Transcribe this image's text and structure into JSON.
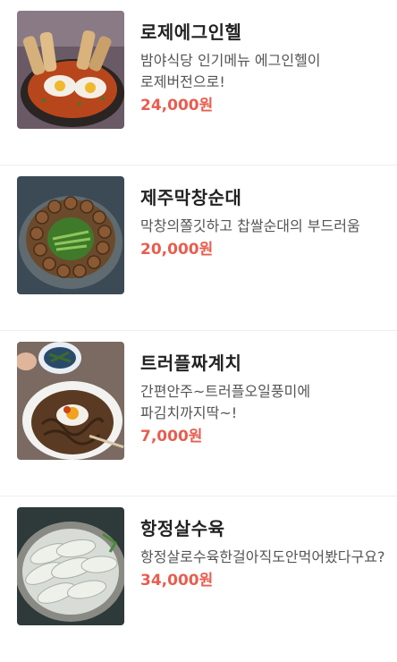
{
  "menu": {
    "items": [
      {
        "name": "로제에그인헬",
        "description": "밤야식당 인기메뉴 에그인헬이 로제버전으로!",
        "price": "24,000원",
        "image": "egg-in-hell-photo"
      },
      {
        "name": "제주막창순대",
        "description": "막창의쫄깃하고 찹쌀순대의 부드러움",
        "price": "20,000원",
        "image": "makchang-sundae-photo"
      },
      {
        "name": "트러플짜계치",
        "description": "간편안주~트러플오일풍미에 파김치까지딱~!",
        "price": "7,000원",
        "image": "truffle-jjagyechi-photo"
      },
      {
        "name": "항정살수육",
        "description": "항정살로수육한걸아직도안먹어봤다구요?",
        "price": "34,000원",
        "image": "hangjeongsal-suyuk-photo"
      }
    ]
  }
}
